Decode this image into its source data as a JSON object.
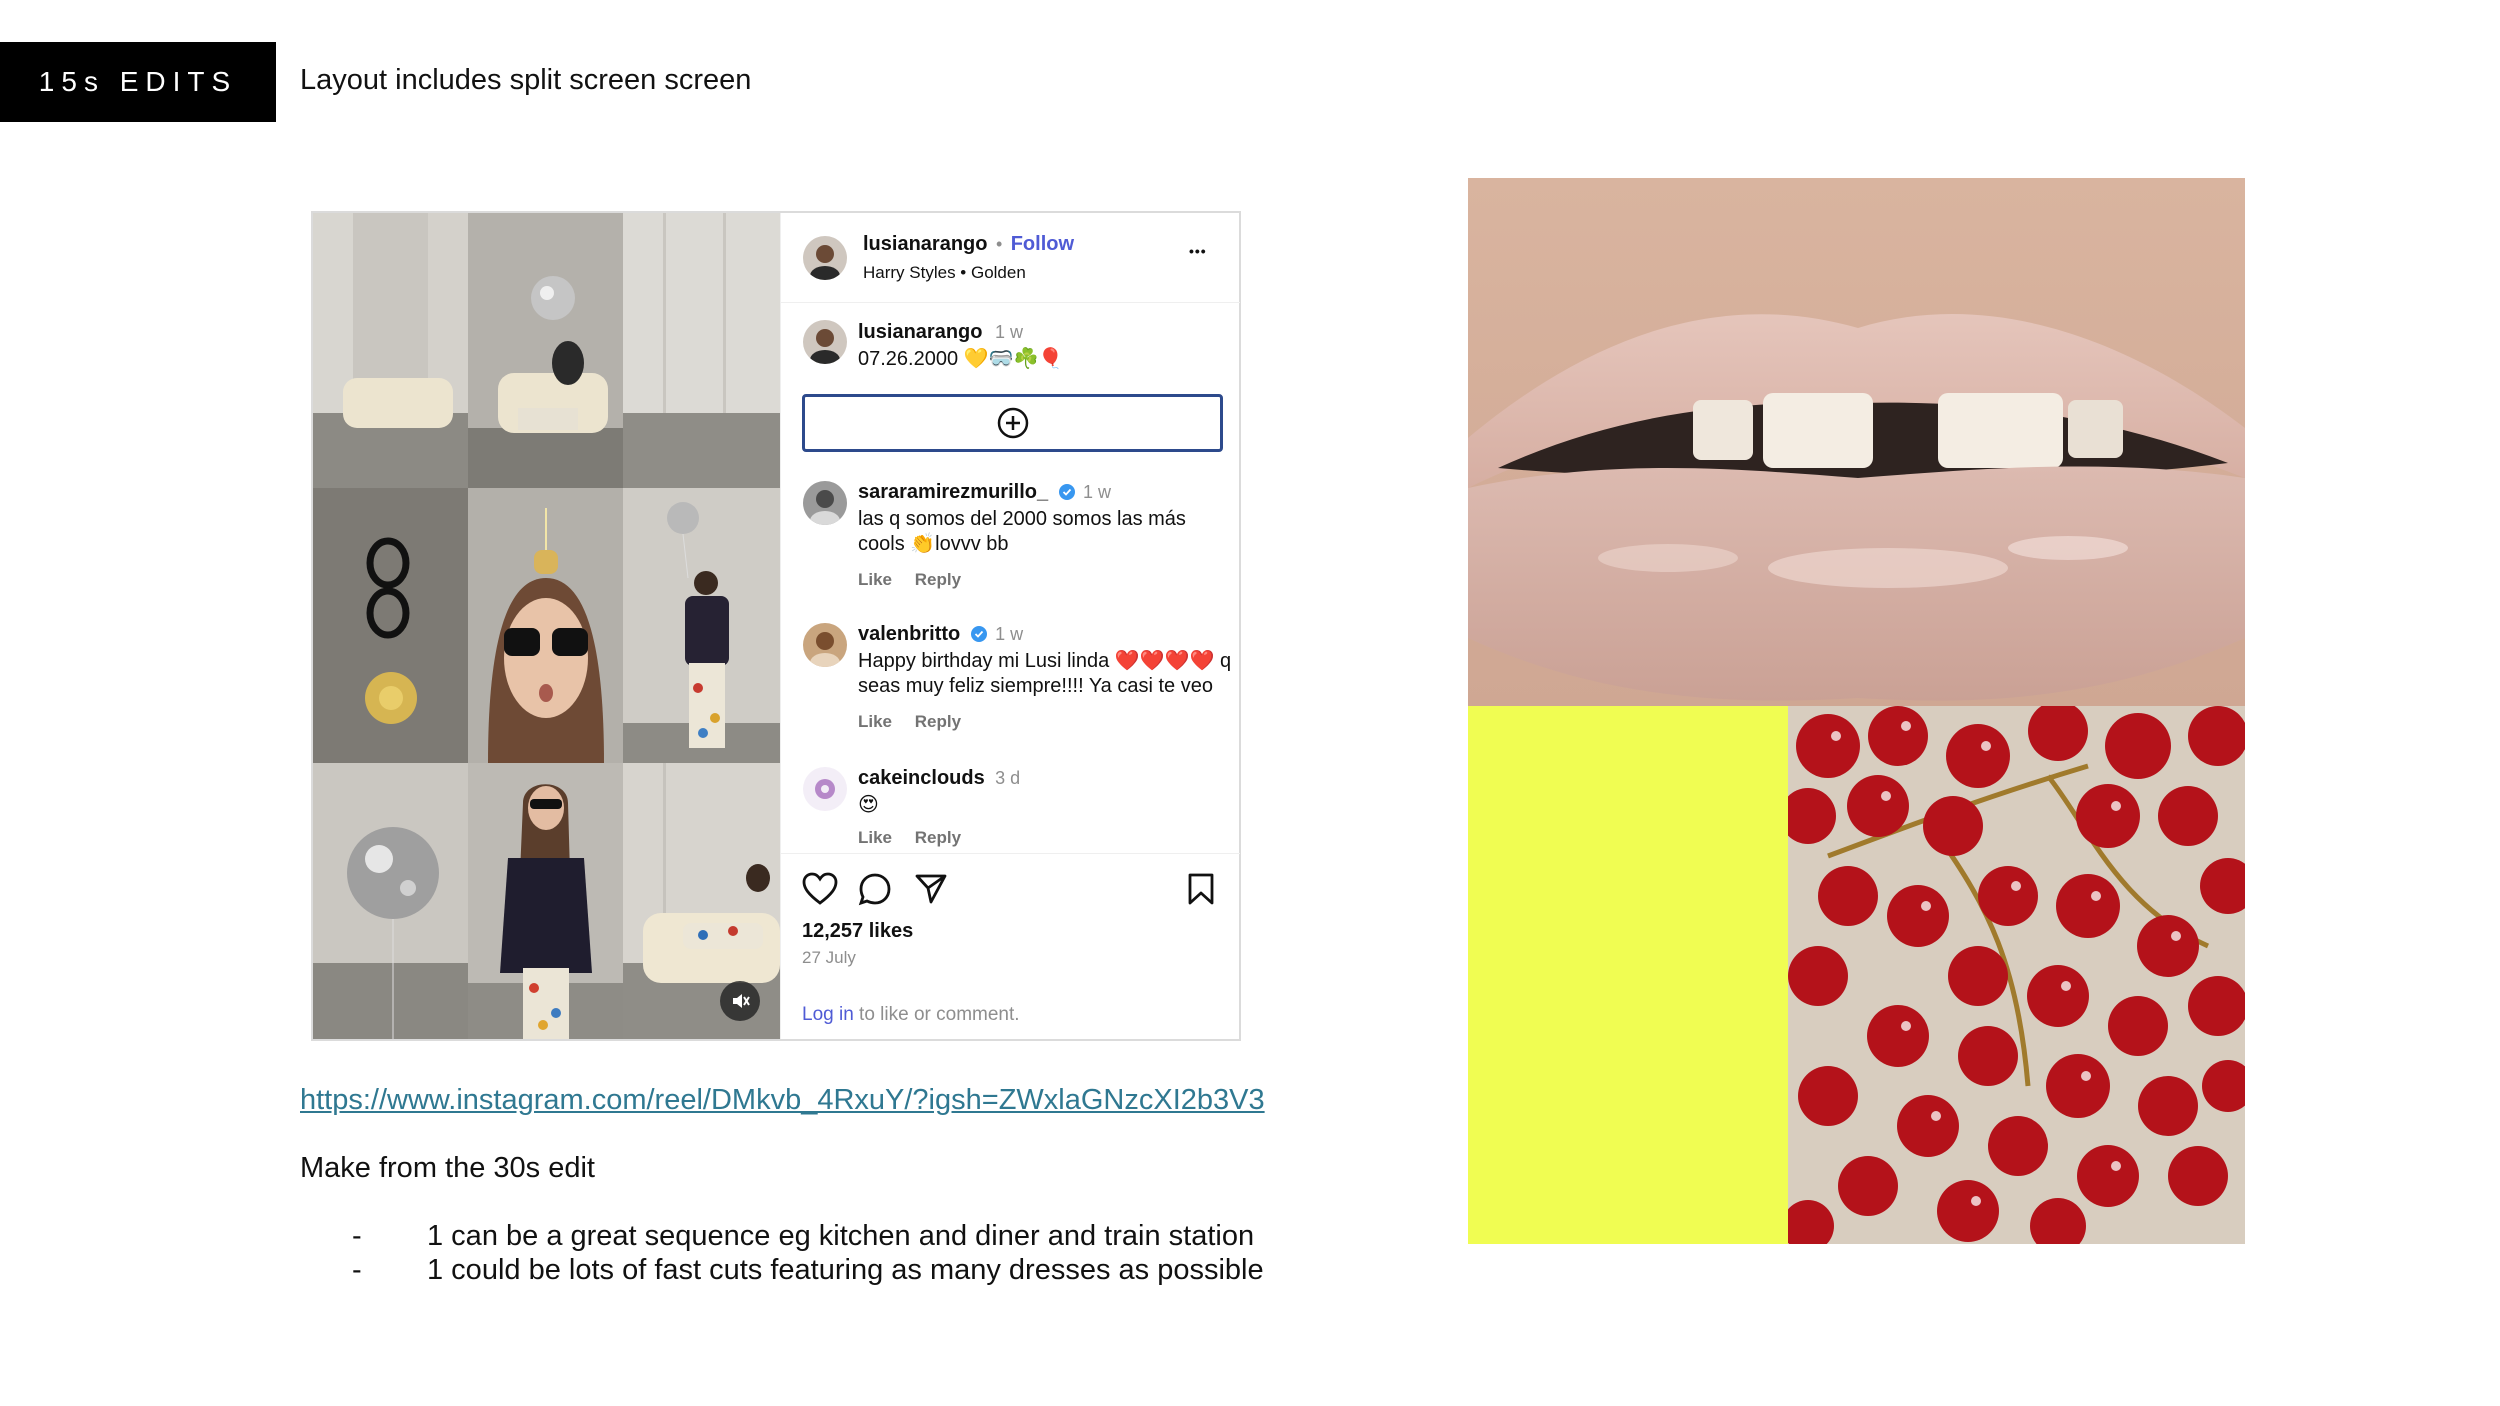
{
  "header": {
    "tag": "15s EDITS",
    "subtitle": "Layout includes split screen screen"
  },
  "instagram": {
    "post": {
      "username": "lusianarango",
      "separator": "•",
      "follow_label": "Follow",
      "audio": "Harry Styles • Golden",
      "more_label": "•••"
    },
    "caption": {
      "username": "lusianarango",
      "time": "1 w",
      "text": "07.26.2000 💛🥽☘️🎈"
    },
    "comments": [
      {
        "username": "sararamirezmurillo_",
        "verified": true,
        "time": "1 w",
        "line1": "las q somos del 2000 somos las más",
        "line2": "cools 👏lovvv bb",
        "like": "Like",
        "reply": "Reply"
      },
      {
        "username": "valenbritto",
        "verified": true,
        "time": "1 w",
        "line1": "Happy birthday mi Lusi linda ❤️❤️❤️❤️ q",
        "line2": "seas muy feliz siempre!!!! Ya casi te veo",
        "like": "Like",
        "reply": "Reply"
      },
      {
        "username": "cakeinclouds",
        "verified": false,
        "time": "3 d",
        "line1": "😍",
        "line2": "",
        "like": "Like",
        "reply": "Reply"
      }
    ],
    "likes": "12,257 likes",
    "date": "27 July",
    "login_link": "Log in",
    "login_rest": " to like or comment."
  },
  "notes": {
    "link": "https://www.instagram.com/reel/DMkvb_4RxuY/?igsh=ZWxlaGNzcXI2b3V3",
    "make": "Make from the 30s edit",
    "bullets": [
      {
        "dash": "-",
        "text": "1 can be a great sequence eg kitchen and diner and train station"
      },
      {
        "dash": "-",
        "text": "1 could be lots of fast cuts featuring as many dresses as possible"
      }
    ]
  },
  "colors": {
    "accent_blue": "#4f5bd5",
    "link_teal": "#2f7891",
    "yellow_block": "#f0fd52",
    "berry_red": "#b4121a"
  },
  "icons": {
    "heart": "heart-icon",
    "comment": "comment-icon",
    "share": "send-icon",
    "save": "bookmark-icon",
    "add": "plus-circle-icon",
    "mute": "mute-icon",
    "more": "more-icon"
  }
}
